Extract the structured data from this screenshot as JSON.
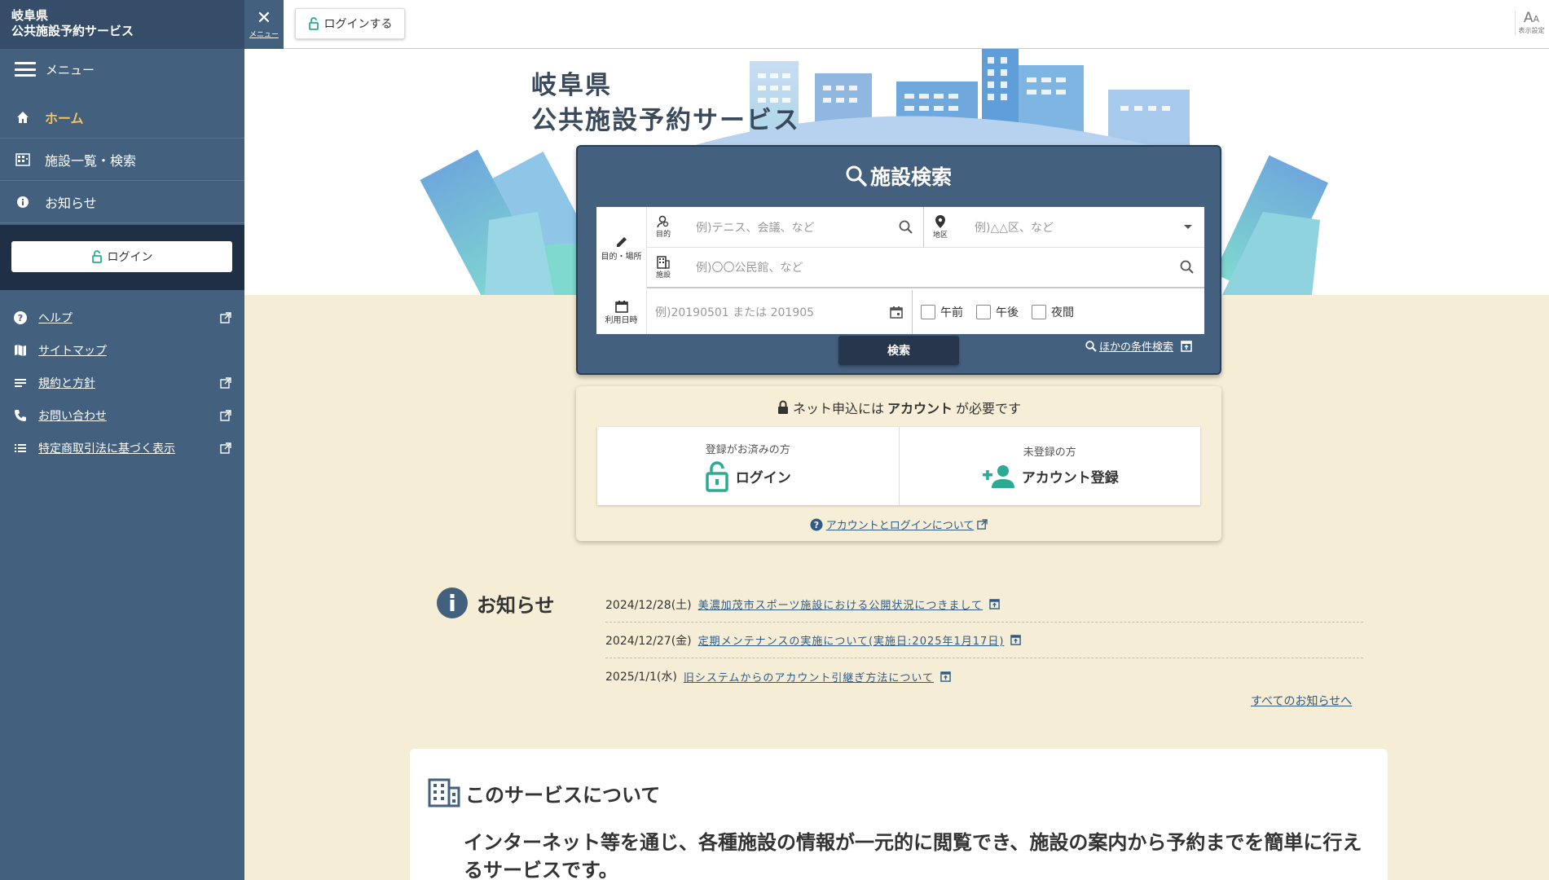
{
  "site": {
    "title_line1": "岐阜県",
    "title_line2": "公共施設予約サービス"
  },
  "sidebar": {
    "menu_label": "メニュー",
    "nav": [
      {
        "label": "ホーム",
        "icon": "home-icon"
      },
      {
        "label": "施設一覧・検索",
        "icon": "building-icon"
      },
      {
        "label": "お知らせ",
        "icon": "info-icon"
      }
    ],
    "login_label": "ログイン",
    "links": [
      {
        "label": "ヘルプ",
        "icon": "help-icon"
      },
      {
        "label": "サイトマップ",
        "icon": "map-icon"
      },
      {
        "label": "規約と方針",
        "icon": "list-icon"
      },
      {
        "label": "お問い合わせ",
        "icon": "phone-icon"
      },
      {
        "label": "特定商取引法に基づく表示",
        "icon": "bullet-list-icon"
      }
    ]
  },
  "topbar": {
    "close_label": "メニュー",
    "login_label": "ログインする",
    "display_settings": "表示設定"
  },
  "hero": {
    "title_line1": "岐阜県",
    "title_line2": "公共施設予約サービス"
  },
  "search": {
    "title": "施設検索",
    "purpose_place_label": "目的・場所",
    "purpose_label": "目的",
    "purpose_placeholder": "例)テニス、会議、など",
    "area_label": "地区",
    "area_placeholder": "例)△△区、など",
    "facility_label": "施設",
    "facility_placeholder": "例)〇〇公民館、など",
    "date_label": "利用日時",
    "date_placeholder": "例)20190501 または 201905",
    "times": [
      "午前",
      "午後",
      "夜間"
    ],
    "search_button": "検索",
    "other_search": "ほかの条件検索"
  },
  "account": {
    "note_prefix": "ネット申込には",
    "note_bold": "アカウント",
    "note_suffix": "が必要です",
    "registered_sub": "登録がお済みの方",
    "login_label": "ログイン",
    "unregistered_sub": "未登録の方",
    "register_label": "アカウント登録",
    "about_link": "アカウントとログインについて"
  },
  "news": {
    "heading": "お知らせ",
    "items": [
      {
        "date": "2024/12/28(土)",
        "title": "美濃加茂市スポーツ施設における公開状況につきまして"
      },
      {
        "date": "2024/12/27(金)",
        "title": "定期メンテナンスの実施について(実施日:2025年1月17日)"
      },
      {
        "date": "2025/1/1(水)",
        "title": "旧システムからのアカウント引継ぎ方法について"
      }
    ],
    "all_link": "すべてのお知らせへ"
  },
  "about": {
    "title": "このサービスについて",
    "text": "インターネット等を通じ、各種施設の情報が一元的に閲覧でき、施設の案内から予約までを簡単に行えるサービスです。"
  },
  "colors": {
    "sidebar": "#43607e",
    "accent": "#f5c35b",
    "green": "#2bab94",
    "cream": "#f5edd5",
    "dark_button": "#27364a"
  }
}
